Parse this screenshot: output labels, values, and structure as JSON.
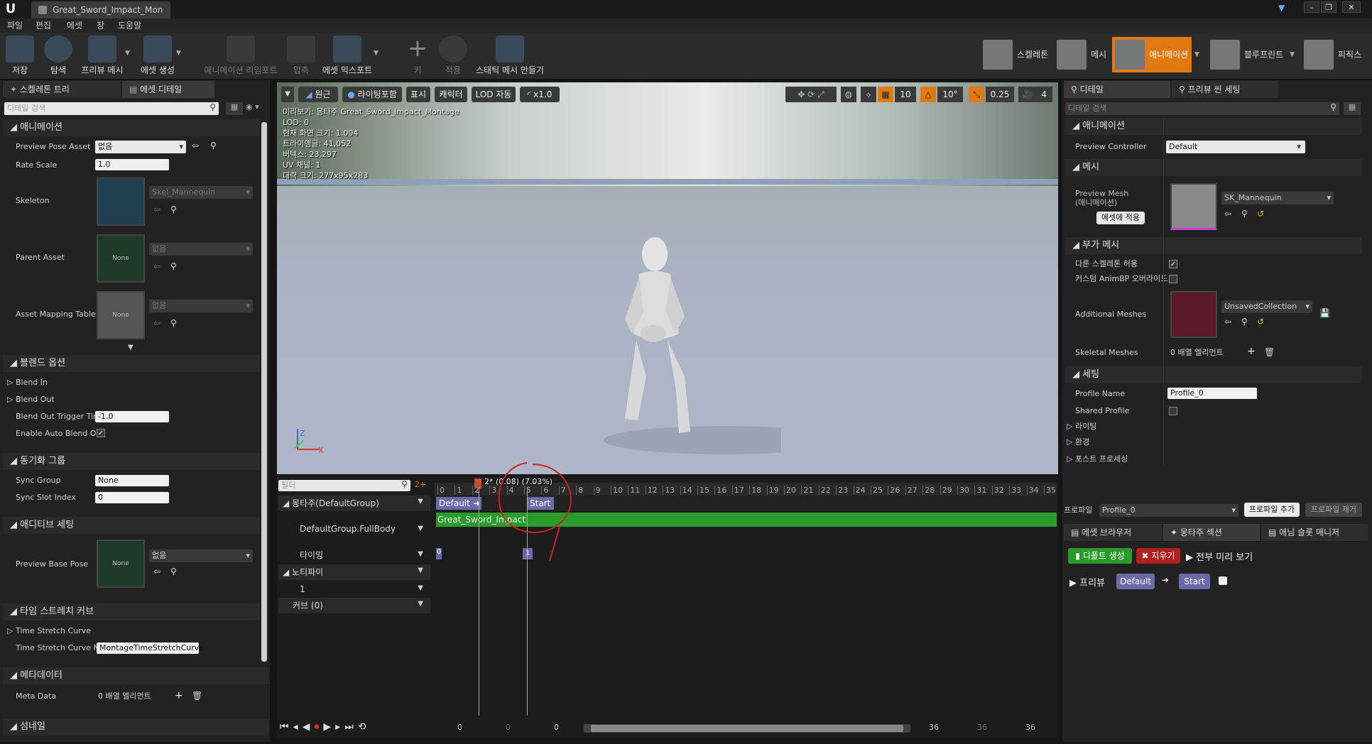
{
  "window": {
    "tab_title": "Great_Sword_Impact_Mon",
    "min": "–",
    "max": "❐",
    "close": "✕"
  },
  "menu": [
    "파일",
    "편집",
    "에셋",
    "창",
    "도움말"
  ],
  "toolbar": {
    "buttons": [
      "저장",
      "탐색",
      "프리뷰 메시",
      "에셋 생성",
      "애니메이션 리임포트",
      "압축",
      "에셋 익스포트",
      "키",
      "적용",
      "스태틱 메시 만들기"
    ],
    "modes": [
      "스켈레톤",
      "메시",
      "애니메이션",
      "블루프린트",
      "피직스"
    ]
  },
  "left_panel": {
    "tabs": [
      "스켈레톤 트리",
      "에셋 디테일"
    ],
    "search_placeholder": "디테일 검색",
    "sections": {
      "animation": "애니메이션",
      "blend": "블렌드 옵션",
      "sync": "동기화 그룹",
      "additive": "애디티브 세팅",
      "timestretch": "타임 스트레치 커브",
      "metadata": "메타데이터",
      "thumbnail": "섬네일"
    },
    "props": {
      "preview_pose_asset": "Preview Pose Asset",
      "preview_pose_value": "없음",
      "rate_scale": "Rate Scale",
      "rate_scale_value": "1.0",
      "skeleton": "Skeleton",
      "skeleton_value": "Skel_Mannequin",
      "parent_asset": "Parent Asset",
      "parent_value": "없음",
      "none": "None",
      "asset_mapping": "Asset Mapping Table",
      "asset_mapping_value": "없음",
      "blend_in": "Blend In",
      "blend_out": "Blend Out",
      "blend_out_trigger": "Blend Out Trigger Tim",
      "blend_out_trigger_value": "-1.0",
      "auto_blend": "Enable Auto Blend Ou",
      "sync_group": "Sync Group",
      "sync_group_value": "None",
      "sync_slot": "Sync Slot Index",
      "sync_slot_value": "0",
      "preview_base_pose": "Preview Base Pose",
      "preview_base_value": "없음",
      "ts_curve": "Time Stretch Curve",
      "ts_curve_n": "Time Stretch Curve N",
      "ts_curve_n_value": "MontageTimeStretchCurve",
      "meta_data": "Meta Data",
      "meta_data_value": "0 배열 엘리먼트"
    }
  },
  "viewport": {
    "toolbar": [
      "원근",
      "라이팅포함",
      "표시",
      "캐릭터",
      "LOD 자동",
      "x1.0"
    ],
    "right_vals": [
      "10",
      "10°",
      "0.25",
      "4"
    ],
    "info": [
      "미리보기: 몽타주 Great_Sword_Impact_Montage",
      "LOD: 0",
      "현재 화면 크기: 1.004",
      "트라이앵글: 41,052",
      "버텍스: 23,297",
      "UV 채널: 1",
      "대략 크기: 277x95x283"
    ],
    "axis_z": "Z",
    "axis_x": "X"
  },
  "timeline": {
    "filter_placeholder": "필터",
    "frame_marker": "2* (0.08) (7.03%)",
    "tracks": [
      "몽타주(DefaultGroup)",
      "DefaultGroup.FullBody",
      "타이밍",
      "노티파이",
      "1",
      "커브 (0)"
    ],
    "section_default": "Default",
    "section_start": "Start",
    "segment": "Great_Sword_Impact",
    "timing_left": "0",
    "timing_marker": "1",
    "ticks": [
      "0",
      "1",
      "2",
      "3",
      "4",
      "5",
      "6",
      "7",
      "8",
      "9",
      "10",
      "11",
      "12",
      "13",
      "14",
      "15",
      "16",
      "17",
      "18",
      "19",
      "20",
      "21",
      "22",
      "23",
      "24",
      "25",
      "26",
      "27",
      "28",
      "29",
      "30",
      "31",
      "32",
      "33",
      "34",
      "35"
    ],
    "bottom": {
      "a": "0",
      "b": "0",
      "c": "0",
      "d": "36",
      "e": "36",
      "f": "36"
    },
    "current_frame": 2
  },
  "right_panel": {
    "tabs": [
      "디테일",
      "프리뷰 씬 세팅"
    ],
    "search_placeholder": "디테일 검색",
    "sections": {
      "animation": "애니메이션",
      "mesh": "메시",
      "addmesh": "부가 메시",
      "settings": "세팅"
    },
    "preview_controller": "Preview Controller",
    "preview_controller_value": "Default",
    "preview_mesh": "Preview Mesh",
    "preview_mesh_sub": "(애니메이션)",
    "apply_to_asset": "에셋에 적용",
    "mesh_value": "SK_Mannequin",
    "allow_diff_skel": "다른 스켈레톤 허용",
    "custom_animbp": "커스텀 AnimBP 오버라이드",
    "additional_meshes": "Additional Meshes",
    "additional_value": "UnsavedCollection",
    "skeletal_meshes": "Skeletal Meshes",
    "skeletal_value": "0 배열 엘리먼트",
    "profile_name": "Profile Name",
    "profile_name_value": "Profile_0",
    "shared_profile": "Shared Profile",
    "lighting": "라이팅",
    "environment": "환경",
    "postprocess": "포스트 프로세싱",
    "profile_label": "프로파일",
    "profile_value": "Profile_0",
    "add_profile": "프로파일 추가",
    "remove_profile": "프로파일 제거"
  },
  "bottom_right": {
    "tabs": [
      "에셋 브라우저",
      "몽타주 섹션",
      "애님 슬롯 매니저"
    ],
    "create_default": "디폴트 생성",
    "clear": "지우기",
    "preview_all": "전부 미리 보기",
    "preview": "프리뷰",
    "default": "Default",
    "start": "Start"
  }
}
